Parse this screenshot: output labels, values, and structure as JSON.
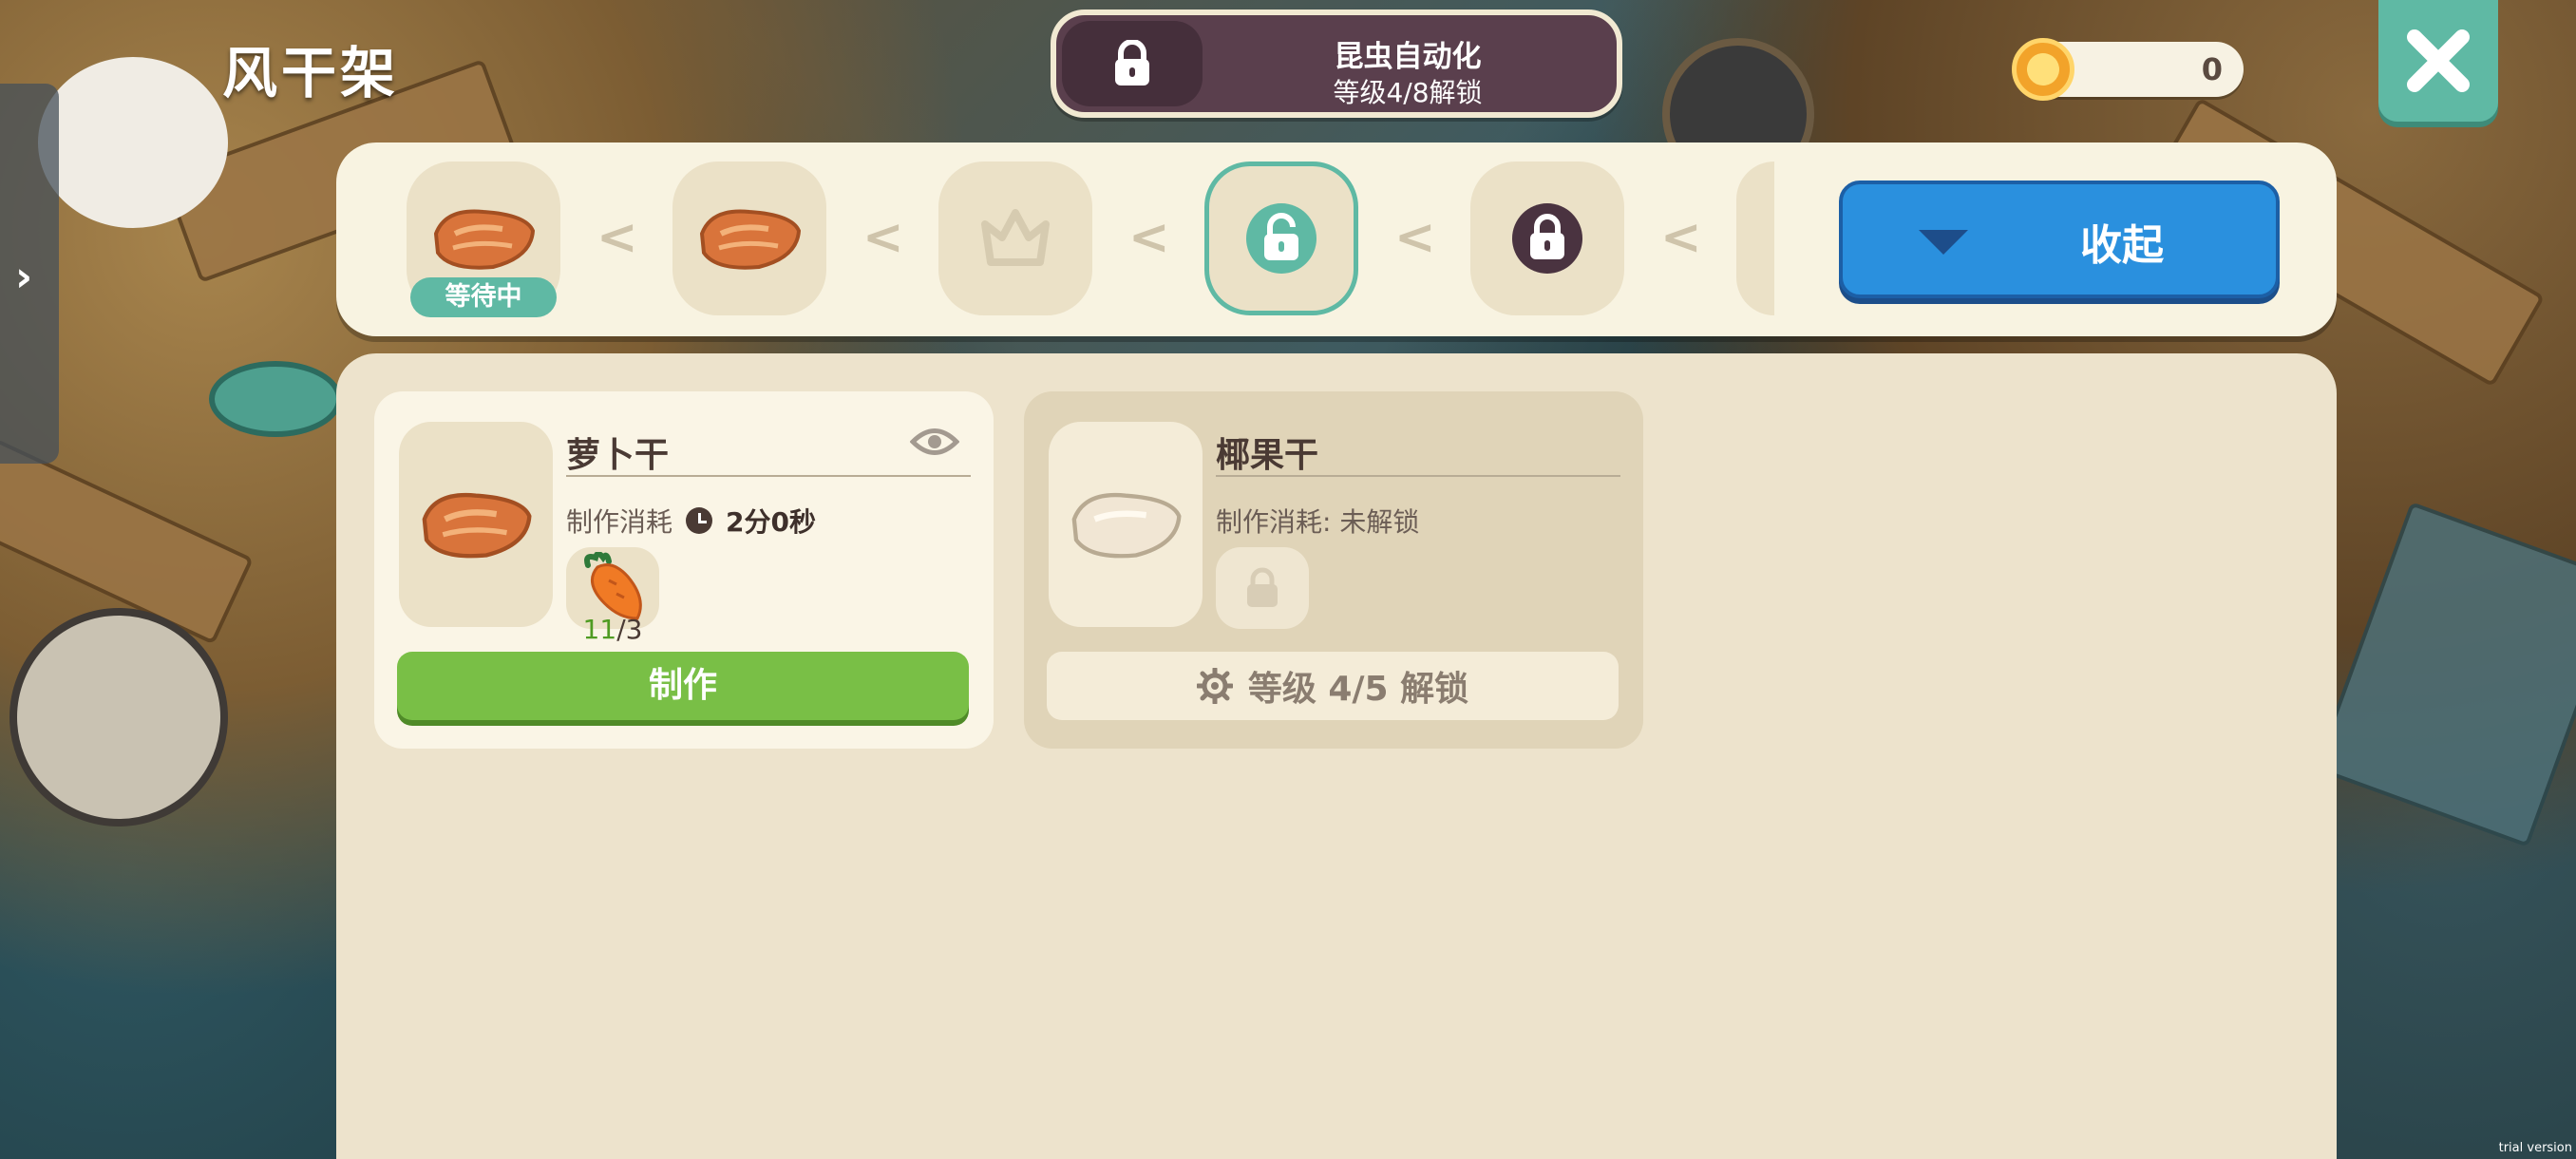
{
  "header": {
    "title": "风干架",
    "unlock_banner": {
      "line1": "昆虫自动化",
      "line2": "等级4/8解锁"
    },
    "currency": {
      "value": "0",
      "icon": "coin-icon"
    },
    "close_icon": "close-icon"
  },
  "chain": {
    "arrow_glyph": "<",
    "slots": [
      {
        "item": "dried-radish-icon",
        "status": "等待中"
      },
      {
        "item": "dried-radish-icon"
      },
      {
        "item": "crown-icon",
        "state": "empty"
      },
      {
        "item": "unlocked-lock-icon",
        "state": "selected"
      },
      {
        "item": "lock-icon",
        "state": "locked"
      }
    ],
    "collapse_label": "收起"
  },
  "recipes": [
    {
      "name": "萝卜干",
      "cost_label": "制作消耗",
      "time": "2分0秒",
      "ingredient": {
        "icon": "carrot-icon",
        "have": "11",
        "need": "/3"
      },
      "action_label": "制作"
    },
    {
      "name": "椰果干",
      "cost_label": "制作消耗: 未解锁",
      "requirement": "等级 4/5 解锁"
    }
  ],
  "watermark": "trial version",
  "colors": {
    "accent_teal": "#5fb9a4",
    "button_blue": "#2a90de",
    "button_green": "#79bf46",
    "panel_cream": "#f8f3e1",
    "banner_purple": "#5a3f4d"
  }
}
